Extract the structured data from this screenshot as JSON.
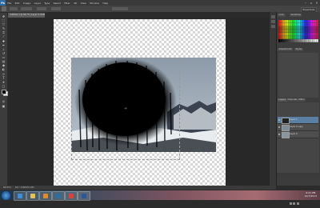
{
  "app": {
    "name": "Photoshop",
    "logo_text": "Ps"
  },
  "menu": [
    "File",
    "Edit",
    "Image",
    "Layer",
    "Type",
    "Select",
    "Filter",
    "3D",
    "View",
    "Window",
    "Help"
  ],
  "window_controls": [
    "minimize",
    "restore",
    "close"
  ],
  "options_bar": {
    "workspace_label": "Essentials"
  },
  "document": {
    "tab_label": "Untitled-1 @ 66.7% (Layer 0, RGB/8)",
    "background": "transparent-checkerboard"
  },
  "tools": [
    "move-icon",
    "marquee-icon",
    "lasso-icon",
    "quick-select-icon",
    "crop-icon",
    "eyedropper-icon",
    "healing-brush-icon",
    "brush-icon",
    "clone-stamp-icon",
    "history-brush-icon",
    "eraser-icon",
    "gradient-icon",
    "blur-icon",
    "dodge-icon",
    "pen-icon",
    "type-icon",
    "path-select-icon",
    "shape-icon",
    "hand-icon",
    "zoom-icon"
  ],
  "colors": {
    "foreground": "#000000",
    "background": "#ffffff",
    "accent": "#5b7ea3"
  },
  "panels": {
    "top_tabs": [
      "Color",
      "Swatches"
    ],
    "adjust_tabs": [
      "Adjustments",
      "Styles"
    ],
    "layers_tabs": [
      "Layers",
      "Channels",
      "Paths"
    ],
    "layers": [
      {
        "name": "Layer 1",
        "selected": true
      },
      {
        "name": "Layer 0 copy",
        "selected": false
      },
      {
        "name": "Layer 0",
        "selected": false
      }
    ]
  },
  "status": {
    "zoom": "66.67%",
    "doc_info": "Doc: 3.00M/5.12M"
  },
  "taskbar": {
    "apps": [
      "ie-icon",
      "folder-icon",
      "media-player-icon",
      "photoshop-icon",
      "chrome-icon",
      "word-icon"
    ],
    "time": "9:41 PM",
    "date": "12/7/2013"
  }
}
